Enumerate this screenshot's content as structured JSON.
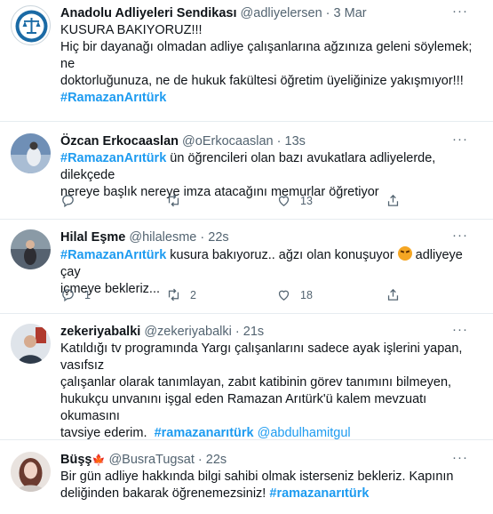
{
  "tweets": [
    {
      "name": "Anadolu Adliyeleri Sendikası",
      "handle": "@adliyelersen",
      "sep": "·",
      "time": "3 Mar",
      "line1": "KUSURA BAKIYORUZ!!!",
      "line2": "Hiç bir dayanağı olmadan adliye çalışanlarına  ağzınıza geleni söylemek; ne",
      "line3": "doktorluğunuza, ne de hukuk fakültesi öğretim üyeliğinize yakışmıyor!!!",
      "hashtag": "#RamazanArıtürk"
    },
    {
      "name": "Özcan Erkocaaslan",
      "handle": "@oErkocaaslan",
      "sep": "·",
      "time": "13s",
      "hashtag": "#RamazanArıtürk",
      "line1_rest": " ün öğrencileri olan bazı avukatlara adliyelerde, dilekçede",
      "line2": "nereye başlık nereye imza atacağını memurlar öğretiyor",
      "reply_count": "",
      "retweet_count": "",
      "like_count": "13"
    },
    {
      "name": "Hilal Eşme",
      "handle": "@hilalesme",
      "sep": "·",
      "time": "22s",
      "hashtag": "#RamazanArıtürk",
      "line1_rest": " kusura bakıyoruz.. ağzı olan konuşuyor ",
      "line1_tail": " adliyeye çay",
      "line2": "içmeye bekleriz...",
      "emoji": "angry-face-emoji",
      "reply_count": "1",
      "retweet_count": "2",
      "like_count": "18"
    },
    {
      "name": "zekeriyabalki",
      "handle": "@zekeriyabalki",
      "sep": "·",
      "time": "21s",
      "line1": "Katıldığı tv programında Yargı çalışanlarını sadece ayak işlerini yapan, vasıfsız",
      "line2": "çalışanlar olarak tanımlayan, zabıt katibinin görev tanımını bilmeyen,",
      "line3": "hukukçu unvanını işgal eden Ramazan Arıtürk'ü kalem mevzuatı okumasını",
      "line4": "tavsiye ederim.",
      "hashtag": "#ramazanarıtürk",
      "mention": "@abdulhamitgul"
    },
    {
      "name": "Büşş",
      "flag": "🍁",
      "handle": "@BusraTugsat",
      "sep": "·",
      "time": "22s",
      "line1": "Bir gün adliye hakkında bilgi sahibi olmak isterseniz bekleriz. Kapının",
      "line2": "deliğinden bakarak öğrenemezsiniz!",
      "hashtag": "#ramazanarıtürk"
    }
  ],
  "more_glyph": "···"
}
